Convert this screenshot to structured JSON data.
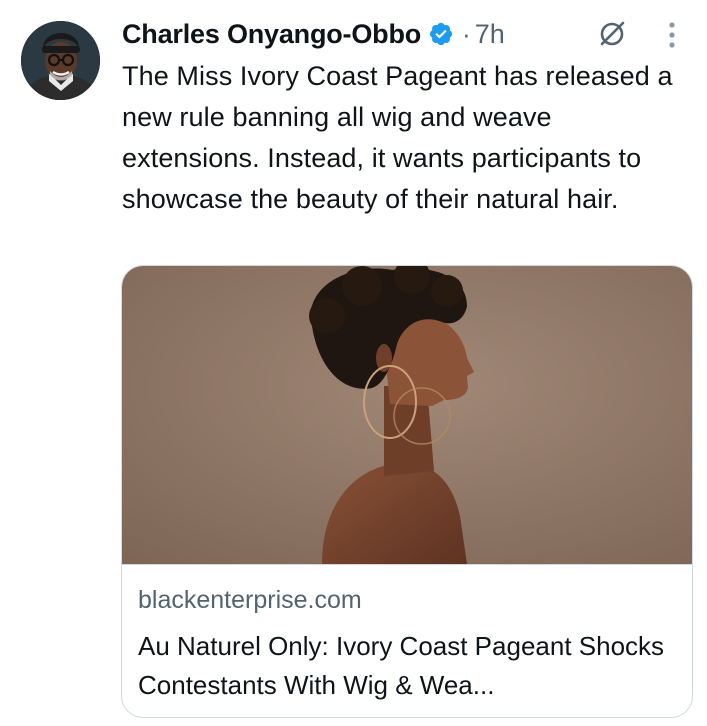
{
  "tweet": {
    "author_name": "Charles Onyango-Obbo",
    "separator": "·",
    "timestamp": "7h",
    "text": "The Miss Ivory Coast Pageant has released a new rule banning all wig and weave extensions. Instead, it wants participants to showcase the beauty of their natural hair."
  },
  "link_card": {
    "domain": "blackenterprise.com",
    "title": "Au Naturel Only: Ivory Coast Pageant Shocks Contestants With Wig & Wea..."
  },
  "icons": {
    "verified": "verified-badge-icon",
    "grok": "grok-icon",
    "more": "more-options-icon"
  },
  "colors": {
    "verified_blue": "#1d9bf0",
    "secondary_text": "#536471",
    "primary_text": "#0f1419",
    "card_border": "#cfd9de"
  }
}
